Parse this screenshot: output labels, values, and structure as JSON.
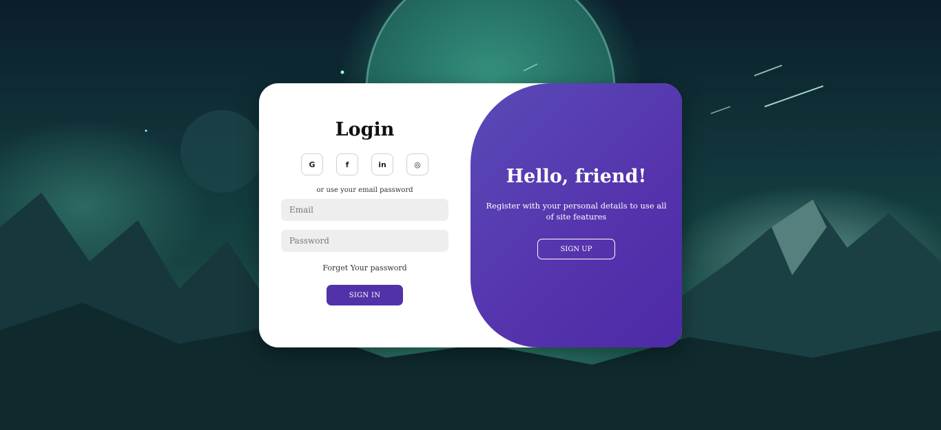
{
  "login": {
    "title": "Login",
    "social": [
      {
        "icon": "google-icon",
        "glyph": "G"
      },
      {
        "icon": "facebook-icon",
        "glyph": "f"
      },
      {
        "icon": "linkedin-icon",
        "glyph": "in"
      },
      {
        "icon": "github-icon",
        "glyph": "◎"
      }
    ],
    "hint": "or use your email password",
    "email_placeholder": "Email",
    "password_placeholder": "Password",
    "forgot": "Forget Your password",
    "signin_label": "SIGN IN"
  },
  "promo": {
    "title": "Hello, friend!",
    "text": "Register with your personal details to use all of site features",
    "signup_label": "SIGN UP"
  },
  "colors": {
    "accent": "#5132a8",
    "panel_start": "#5a4ab7",
    "panel_end": "#4e2aa6"
  }
}
